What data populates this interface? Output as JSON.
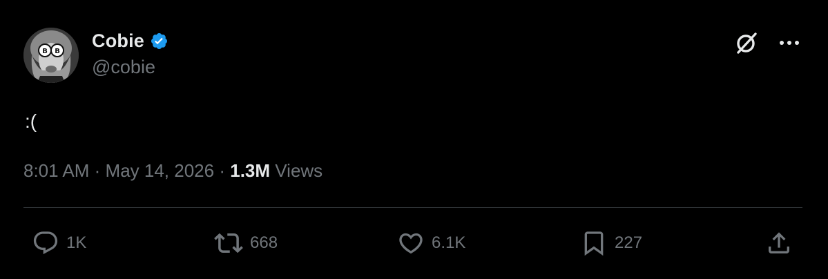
{
  "author": {
    "display_name": "Cobie",
    "handle": "@cobie",
    "verified_color": "#1d9bf0"
  },
  "tweet": {
    "text": ":(",
    "time": "8:01 AM",
    "sep1": "·",
    "date": "May 14, 2026",
    "sep2": "·",
    "views_count": "1.3M",
    "views_label": "Views"
  },
  "actions": {
    "reply_count": "1K",
    "retweet_count": "668",
    "like_count": "6.1K",
    "bookmark_count": "227"
  },
  "icons": {
    "reply": "speech-bubble-icon",
    "retweet": "retweet-icon",
    "like": "heart-icon",
    "bookmark": "bookmark-icon",
    "share": "share-upload-icon",
    "grok": "grok-icon",
    "more": "more-dots-icon"
  },
  "colors": {
    "background": "#000000",
    "text_primary": "#e7e9ea",
    "text_secondary": "#71767b",
    "divider": "#2f3336",
    "verified": "#1d9bf0"
  }
}
